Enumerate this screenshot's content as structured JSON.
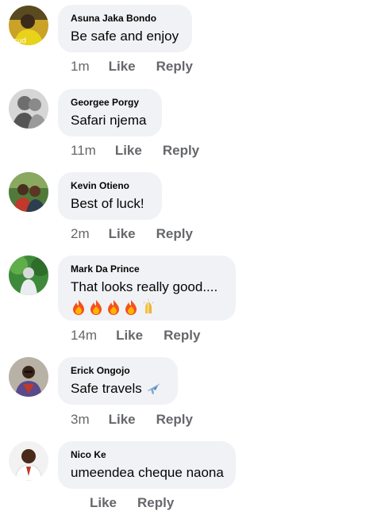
{
  "comments": [
    {
      "author": "Asuna Jaka Bondo",
      "text": "Be safe and enjoy",
      "time": "1m",
      "like": "Like",
      "reply": "Reply"
    },
    {
      "author": "Georgee Porgy",
      "text": "Safari njema",
      "time": "11m",
      "like": "Like",
      "reply": "Reply"
    },
    {
      "author": "Kevin Otieno",
      "text": "Best of luck!",
      "time": "2m",
      "like": "Like",
      "reply": "Reply"
    },
    {
      "author": "Mark Da Prince",
      "text": "That looks really good....",
      "time": "14m",
      "like": "Like",
      "reply": "Reply",
      "emojis": [
        "fire-emoji",
        "fire-emoji",
        "fire-emoji",
        "fire-emoji",
        "folded-hands-emoji"
      ]
    },
    {
      "author": "Erick Ongojo",
      "text": "Safe travels",
      "time": "3m",
      "like": "Like",
      "reply": "Reply",
      "emojis": [
        "airplane-emoji"
      ]
    },
    {
      "author": "Nico Ke",
      "text": "umeendea cheque naona",
      "time": "",
      "like": "Like",
      "reply": "Reply"
    }
  ]
}
